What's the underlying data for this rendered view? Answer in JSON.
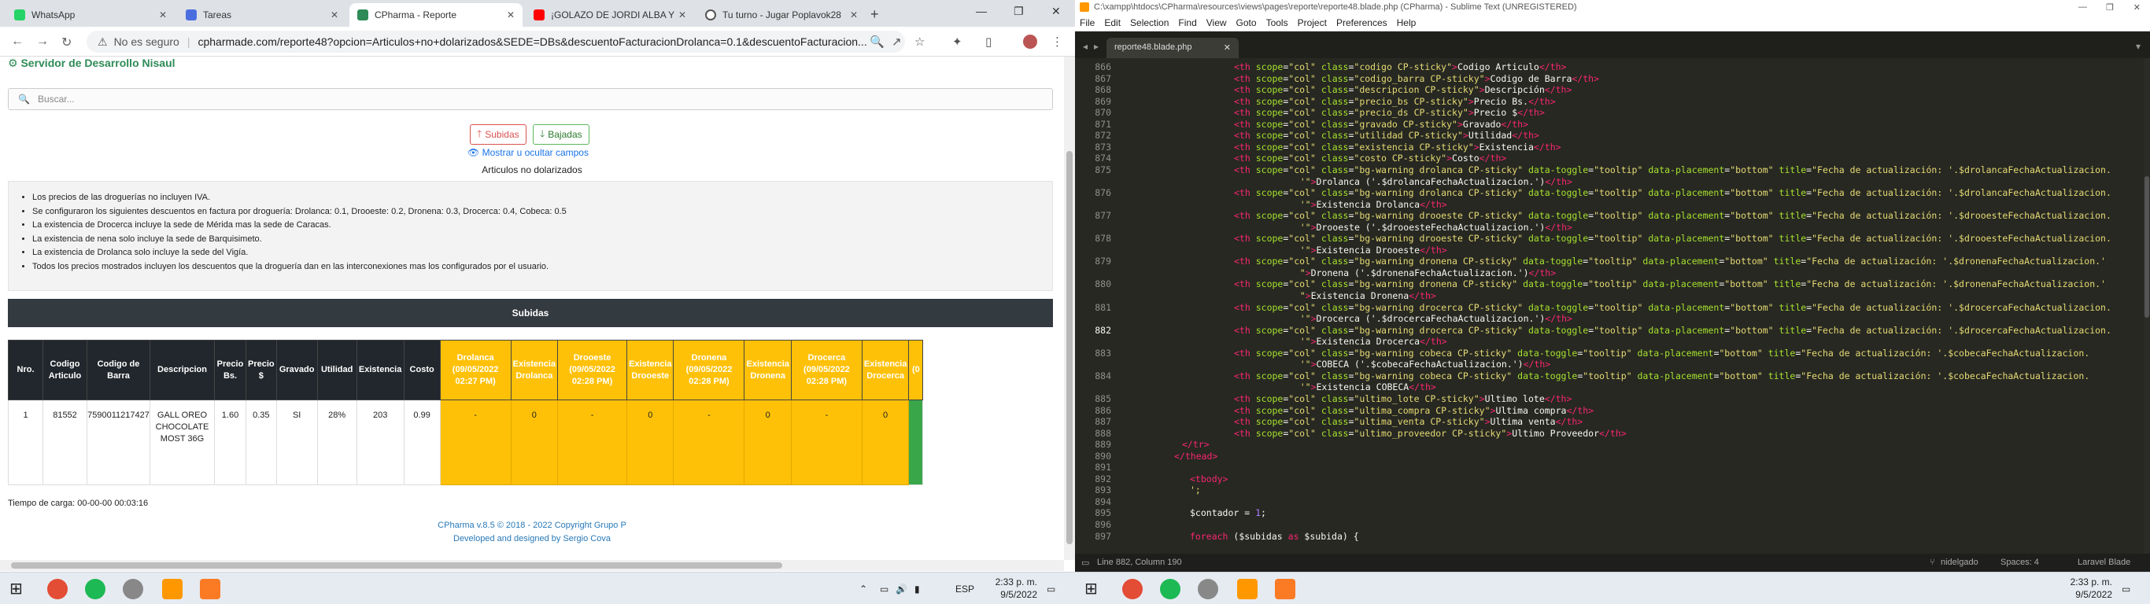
{
  "browser": {
    "tabs": [
      {
        "title": "WhatsApp",
        "color": "#25d366"
      },
      {
        "title": "Tareas",
        "color": "#4a6ee0"
      },
      {
        "title": "CPharma - Reporte",
        "color": "#2e8b57"
      },
      {
        "title": "¡GOLAZO DE JORDI ALBA Y",
        "color": "#ff0000"
      },
      {
        "title": "Tu turno - Jugar Poplavok28",
        "color": "#555555"
      }
    ],
    "security_label": "No es seguro",
    "url": "cpharmade.com/reporte48?opcion=Articulos+no+dolarizados&SEDE=DBs&descuentoFacturacionDrolanca=0.1&descuentoFacturacion..."
  },
  "page": {
    "brand": "Servidor de Desarrollo Nisaul",
    "search_placeholder": "Buscar...",
    "btn_subidas": "Subidas",
    "btn_bajadas": "Bajadas",
    "toggle_fields": "Mostrar u ocultar campos",
    "subtitle": "Articulos no dolarizados",
    "info": [
      "Los precios de las droguerías no incluyen IVA.",
      "Se configuraron los siguientes descuentos en factura por droguería: Drolanca: 0.1, Drooeste: 0.2, Dronena: 0.3, Drocerca: 0.4, Cobeca: 0.5",
      "La existencia de Drocerca incluye la sede de Mérida mas la sede de Caracas.",
      "La existencia de nena solo incluye la sede de Barquisimeto.",
      "La existencia de Drolanca solo incluye la sede del Vigía.",
      "Todos los precios mostrados incluyen los descuentos que la droguería dan en las interconexiones mas los configurados por el usuario."
    ],
    "section_title": "Subidas",
    "table_headers": [
      "Nro.",
      "Codigo Articulo",
      "Codigo de Barra",
      "Descripcion",
      "Precio Bs.",
      "Precio $",
      "Gravado",
      "Utilidad",
      "Existencia",
      "Costo",
      "Drolanca (09/05/2022 02:27 PM)",
      "Existencia Drolanca",
      "Drooeste (09/05/2022 02:28 PM)",
      "Existencia Drooeste",
      "Dronena (09/05/2022 02:28 PM)",
      "Existencia Dronena",
      "Drocerca (09/05/2022 02:28 PM)",
      "Existencia Drocerca",
      "(0"
    ],
    "table_row": [
      "1",
      "81552",
      "7590011217427",
      "GALL OREO CHOCOLATE MOST 36G",
      "1.60",
      "0.35",
      "SI",
      "28%",
      "203",
      "0.99",
      "-",
      "0",
      "-",
      "0",
      "-",
      "0",
      "-",
      "0",
      ""
    ],
    "load_time": "Tiempo de carga: 00-00-00 00:03:16",
    "footer_1": "CPharma v.8.5 © 2018 - 2022 Copyright Grupo P",
    "footer_2": "Developed and designed by Sergio Cova"
  },
  "taskbar": {
    "lang": "ESP",
    "time": "2:33 p. m.",
    "date": "9/5/2022"
  },
  "editor": {
    "title": "C:\\xampp\\htdocs\\CPharma\\resources\\views\\pages\\reporte\\reporte48.blade.php (CPharma) - Sublime Text (UNREGISTERED)",
    "menu": [
      "File",
      "Edit",
      "Selection",
      "Find",
      "View",
      "Goto",
      "Tools",
      "Project",
      "Preferences",
      "Help"
    ],
    "tab": "reporte48.blade.php",
    "lines": [
      {
        "n": "866",
        "html": "<span class=t>&lt;th</span> <span class=a>scope</span>=<span class=s>\"col\"</span> <span class=a>class</span>=<span class=s>\"codigo CP-sticky\"</span><span class=t>&gt;</span>Codigo Articulo<span class=t>&lt;/th&gt;</span>"
      },
      {
        "n": "867",
        "html": "<span class=t>&lt;th</span> <span class=a>scope</span>=<span class=s>\"col\"</span> <span class=a>class</span>=<span class=s>\"codigo_barra CP-sticky\"</span><span class=t>&gt;</span>Codigo de Barra<span class=t>&lt;/th&gt;</span>"
      },
      {
        "n": "868",
        "html": "<span class=t>&lt;th</span> <span class=a>scope</span>=<span class=s>\"col\"</span> <span class=a>class</span>=<span class=s>\"descripcion CP-sticky\"</span><span class=t>&gt;</span>Descripción<span class=t>&lt;/th&gt;</span>"
      },
      {
        "n": "869",
        "html": "<span class=t>&lt;th</span> <span class=a>scope</span>=<span class=s>\"col\"</span> <span class=a>class</span>=<span class=s>\"precio_bs CP-sticky\"</span><span class=t>&gt;</span>Precio Bs.<span class=t>&lt;/th&gt;</span>"
      },
      {
        "n": "870",
        "html": "<span class=t>&lt;th</span> <span class=a>scope</span>=<span class=s>\"col\"</span> <span class=a>class</span>=<span class=s>\"precio_ds CP-sticky\"</span><span class=t>&gt;</span>Precio $<span class=t>&lt;/th&gt;</span>"
      },
      {
        "n": "871",
        "html": "<span class=t>&lt;th</span> <span class=a>scope</span>=<span class=s>\"col\"</span> <span class=a>class</span>=<span class=s>\"gravado CP-sticky\"</span><span class=t>&gt;</span>Gravado<span class=t>&lt;/th&gt;</span>"
      },
      {
        "n": "872",
        "html": "<span class=t>&lt;th</span> <span class=a>scope</span>=<span class=s>\"col\"</span> <span class=a>class</span>=<span class=s>\"utilidad CP-sticky\"</span><span class=t>&gt;</span>Utilidad<span class=t>&lt;/th&gt;</span>"
      },
      {
        "n": "873",
        "html": "<span class=t>&lt;th</span> <span class=a>scope</span>=<span class=s>\"col\"</span> <span class=a>class</span>=<span class=s>\"existencia CP-sticky\"</span><span class=t>&gt;</span>Existencia<span class=t>&lt;/th&gt;</span>"
      },
      {
        "n": "874",
        "html": "<span class=t>&lt;th</span> <span class=a>scope</span>=<span class=s>\"col\"</span> <span class=a>class</span>=<span class=s>\"costo CP-sticky\"</span><span class=t>&gt;</span>Costo<span class=t>&lt;/th&gt;</span>"
      },
      {
        "n": "875",
        "html": "<span class=t>&lt;th</span> <span class=a>scope</span>=<span class=s>\"col\"</span> <span class=a>class</span>=<span class=s>\"bg-warning drolanca CP-sticky\"</span> <span class=a>data-toggle</span>=<span class=s>\"tooltip\"</span> <span class=a>data-placement</span>=<span class=s>\"bottom\"</span> <span class=a>title</span>=<span class=s>\"Fecha de actualización: '.$drolancaFechaActualizacion.</span>"
      },
      {
        "n": "",
        "html": "    <span class=s>'\"</span><span class=t>&gt;</span>Drolanca ('.$drolancaFechaActualizacion.')<span class=t>&lt;/th&gt;</span>"
      },
      {
        "n": "876",
        "html": "<span class=t>&lt;th</span> <span class=a>scope</span>=<span class=s>\"col\"</span> <span class=a>class</span>=<span class=s>\"bg-warning drolanca CP-sticky\"</span> <span class=a>data-toggle</span>=<span class=s>\"tooltip\"</span> <span class=a>data-placement</span>=<span class=s>\"bottom\"</span> <span class=a>title</span>=<span class=s>\"Fecha de actualización: '.$drolancaFechaActualizacion.</span>"
      },
      {
        "n": "",
        "html": "    <span class=s>'\"</span><span class=t>&gt;</span>Existencia Drolanca<span class=t>&lt;/th&gt;</span>"
      },
      {
        "n": "877",
        "html": "<span class=t>&lt;th</span> <span class=a>scope</span>=<span class=s>\"col\"</span> <span class=a>class</span>=<span class=s>\"bg-warning drooeste CP-sticky\"</span> <span class=a>data-toggle</span>=<span class=s>\"tooltip\"</span> <span class=a>data-placement</span>=<span class=s>\"bottom\"</span> <span class=a>title</span>=<span class=s>\"Fecha de actualización: '.$drooesteFechaActualizacion.</span>"
      },
      {
        "n": "",
        "html": "    <span class=s>'\"</span><span class=t>&gt;</span>Drooeste ('.$drooesteFechaActualizacion.')<span class=t>&lt;/th&gt;</span>"
      },
      {
        "n": "878",
        "html": "<span class=t>&lt;th</span> <span class=a>scope</span>=<span class=s>\"col\"</span> <span class=a>class</span>=<span class=s>\"bg-warning drooeste CP-sticky\"</span> <span class=a>data-toggle</span>=<span class=s>\"tooltip\"</span> <span class=a>data-placement</span>=<span class=s>\"bottom\"</span> <span class=a>title</span>=<span class=s>\"Fecha de actualización: '.$drooesteFechaActualizacion.</span>"
      },
      {
        "n": "",
        "html": "    <span class=s>'\"</span><span class=t>&gt;</span>Existencia Drooeste<span class=t>&lt;/th&gt;</span>"
      },
      {
        "n": "879",
        "html": "<span class=t>&lt;th</span> <span class=a>scope</span>=<span class=s>\"col\"</span> <span class=a>class</span>=<span class=s>\"bg-warning dronena CP-sticky\"</span> <span class=a>data-toggle</span>=<span class=s>\"tooltip\"</span> <span class=a>data-placement</span>=<span class=s>\"bottom\"</span> <span class=a>title</span>=<span class=s>\"Fecha de actualización: '.$dronenaFechaActualizacion.'</span>"
      },
      {
        "n": "",
        "html": "    <span class=s>\"</span><span class=t>&gt;</span>Dronena ('.$dronenaFechaActualizacion.')<span class=t>&lt;/th&gt;</span>"
      },
      {
        "n": "880",
        "html": "<span class=t>&lt;th</span> <span class=a>scope</span>=<span class=s>\"col\"</span> <span class=a>class</span>=<span class=s>\"bg-warning dronena CP-sticky\"</span> <span class=a>data-toggle</span>=<span class=s>\"tooltip\"</span> <span class=a>data-placement</span>=<span class=s>\"bottom\"</span> <span class=a>title</span>=<span class=s>\"Fecha de actualización: '.$dronenaFechaActualizacion.'</span>"
      },
      {
        "n": "",
        "html": "    <span class=s>\"</span><span class=t>&gt;</span>Existencia Dronena<span class=t>&lt;/th&gt;</span>"
      },
      {
        "n": "881",
        "html": "<span class=t>&lt;th</span> <span class=a>scope</span>=<span class=s>\"col\"</span> <span class=a>class</span>=<span class=s>\"bg-warning drocerca CP-sticky\"</span> <span class=a>data-toggle</span>=<span class=s>\"tooltip\"</span> <span class=a>data-placement</span>=<span class=s>\"bottom\"</span> <span class=a>title</span>=<span class=s>\"Fecha de actualización: '.$drocercaFechaActualizacion.</span>"
      },
      {
        "n": "",
        "html": "    <span class=s>'\"</span><span class=t>&gt;</span>Drocerca ('.$drocercaFechaActualizacion.')<span class=t>&lt;/th&gt;</span>"
      },
      {
        "n": "882",
        "html": "<span class=t>&lt;th</span> <span class=a>scope</span>=<span class=s>\"col\"</span> <span class=a>class</span>=<span class=s>\"bg-warning drocerca CP-sticky\"</span> <span class=a>data-toggle</span>=<span class=s>\"tooltip\"</span> <span class=a>data-placement</span>=<span class=s>\"bottom\"</span> <span class=a>title</span>=<span class=s>\"Fecha de actualización: '.$drocercaFechaActualizacion.</span>"
      },
      {
        "n": "",
        "html": "    <span class=s>'\"</span><span class=t>&gt;</span>Existencia Drocerca<span class=t>&lt;/th&gt;</span>"
      },
      {
        "n": "883",
        "html": "<span class=t>&lt;th</span> <span class=a>scope</span>=<span class=s>\"col\"</span> <span class=a>class</span>=<span class=s>\"bg-warning cobeca CP-sticky\"</span> <span class=a>data-toggle</span>=<span class=s>\"tooltip\"</span> <span class=a>data-placement</span>=<span class=s>\"bottom\"</span> <span class=a>title</span>=<span class=s>\"Fecha de actualización: '.$cobecaFechaActualizacion.</span>"
      },
      {
        "n": "",
        "html": "    <span class=s>'\"</span><span class=t>&gt;</span>COBECA ('.$cobecaFechaActualizacion.')<span class=t>&lt;/th&gt;</span>"
      },
      {
        "n": "884",
        "html": "<span class=t>&lt;th</span> <span class=a>scope</span>=<span class=s>\"col\"</span> <span class=a>class</span>=<span class=s>\"bg-warning cobeca CP-sticky\"</span> <span class=a>data-toggle</span>=<span class=s>\"tooltip\"</span> <span class=a>data-placement</span>=<span class=s>\"bottom\"</span> <span class=a>title</span>=<span class=s>\"Fecha de actualización: '.$cobecaFechaActualizacion.</span>"
      },
      {
        "n": "",
        "html": "    <span class=s>'\"</span><span class=t>&gt;</span>Existencia COBECA<span class=t>&lt;/th&gt;</span>"
      },
      {
        "n": "885",
        "html": "<span class=t>&lt;th</span> <span class=a>scope</span>=<span class=s>\"col\"</span> <span class=a>class</span>=<span class=s>\"ultimo_lote CP-sticky\"</span><span class=t>&gt;</span>Ultimo lote<span class=t>&lt;/th&gt;</span>"
      },
      {
        "n": "886",
        "html": "<span class=t>&lt;th</span> <span class=a>scope</span>=<span class=s>\"col\"</span> <span class=a>class</span>=<span class=s>\"ultima_compra CP-sticky\"</span><span class=t>&gt;</span>Ultima compra<span class=t>&lt;/th&gt;</span>"
      },
      {
        "n": "887",
        "html": "<span class=t>&lt;th</span> <span class=a>scope</span>=<span class=s>\"col\"</span> <span class=a>class</span>=<span class=s>\"ultima_venta CP-sticky\"</span><span class=t>&gt;</span>Ultima venta<span class=t>&lt;/th&gt;</span>"
      },
      {
        "n": "888",
        "html": "<span class=t>&lt;th</span> <span class=a>scope</span>=<span class=s>\"col\"</span> <span class=a>class</span>=<span class=s>\"ultimo_proveedor CP-sticky\"</span><span class=t>&gt;</span>Ultimo Proveedor<span class=t>&lt;/th&gt;</span>"
      },
      {
        "n": "889",
        "html": "<span class=t>&lt;/tr&gt;</span>"
      },
      {
        "n": "890",
        "html": "<span class=t>&lt;/thead&gt;</span>"
      },
      {
        "n": "891",
        "html": ""
      },
      {
        "n": "892",
        "html": "<span class=t>&lt;tbody&gt;</span>"
      },
      {
        "n": "893",
        "html": "<span class=s>';</span>"
      },
      {
        "n": "894",
        "html": ""
      },
      {
        "n": "895",
        "html": "$contador = <span style=color:#ae81ff>1</span>;"
      },
      {
        "n": "896",
        "html": ""
      },
      {
        "n": "897",
        "html": "<span class=t>foreach</span> ($subidas <span class=t>as</span> $subida) {"
      }
    ],
    "status_left": "Line 882, Column 190",
    "status_git": "nidelgado",
    "status_spaces": "Spaces: 4",
    "status_syntax": "Laravel Blade"
  }
}
